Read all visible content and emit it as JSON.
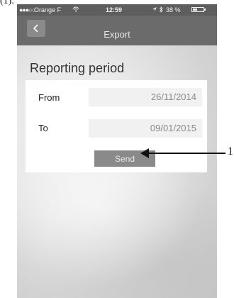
{
  "caption": "(1).",
  "status_bar": {
    "signal": "●●●○○",
    "carrier": "Orange F",
    "time": "12:59",
    "battery_percent": "38 %",
    "battery_level": 0.38
  },
  "nav": {
    "back_glyph": "‹",
    "title": "Export"
  },
  "form": {
    "section_title": "Reporting period",
    "from_label": "From",
    "from_value": "26/11/2014",
    "to_label": "To",
    "to_value": "09/01/2015",
    "send_label": "Send"
  },
  "callout": {
    "number": "1"
  }
}
